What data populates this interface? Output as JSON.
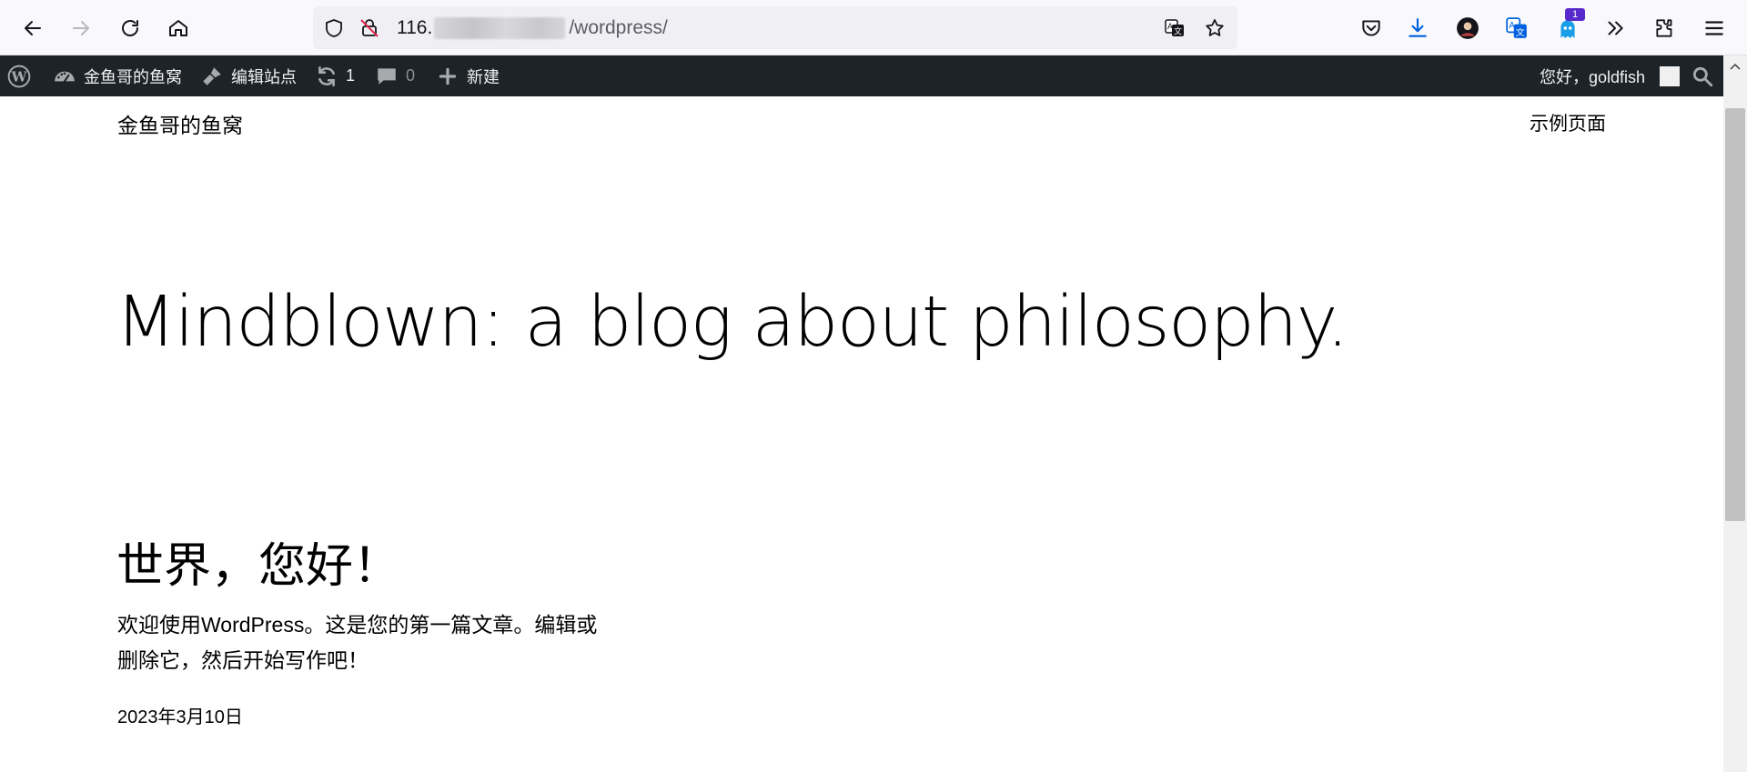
{
  "browser": {
    "url_prefix": "116.",
    "url_path": "/wordpress/",
    "extension_badge": "1"
  },
  "adminbar": {
    "site_name": "金鱼哥的鱼窝",
    "edit_site": "编辑站点",
    "updates_count": "1",
    "comments_count": "0",
    "new_label": "新建",
    "greeting": "您好，goldfish"
  },
  "site": {
    "title": "金鱼哥的鱼窝",
    "nav_page": "示例页面",
    "hero": "Mindblown: a blog about philosophy."
  },
  "post": {
    "title": "世界，您好！",
    "excerpt": "欢迎使用WordPress。这是您的第一篇文章。编辑或删除它，然后开始写作吧！",
    "date": "2023年3月10日"
  }
}
